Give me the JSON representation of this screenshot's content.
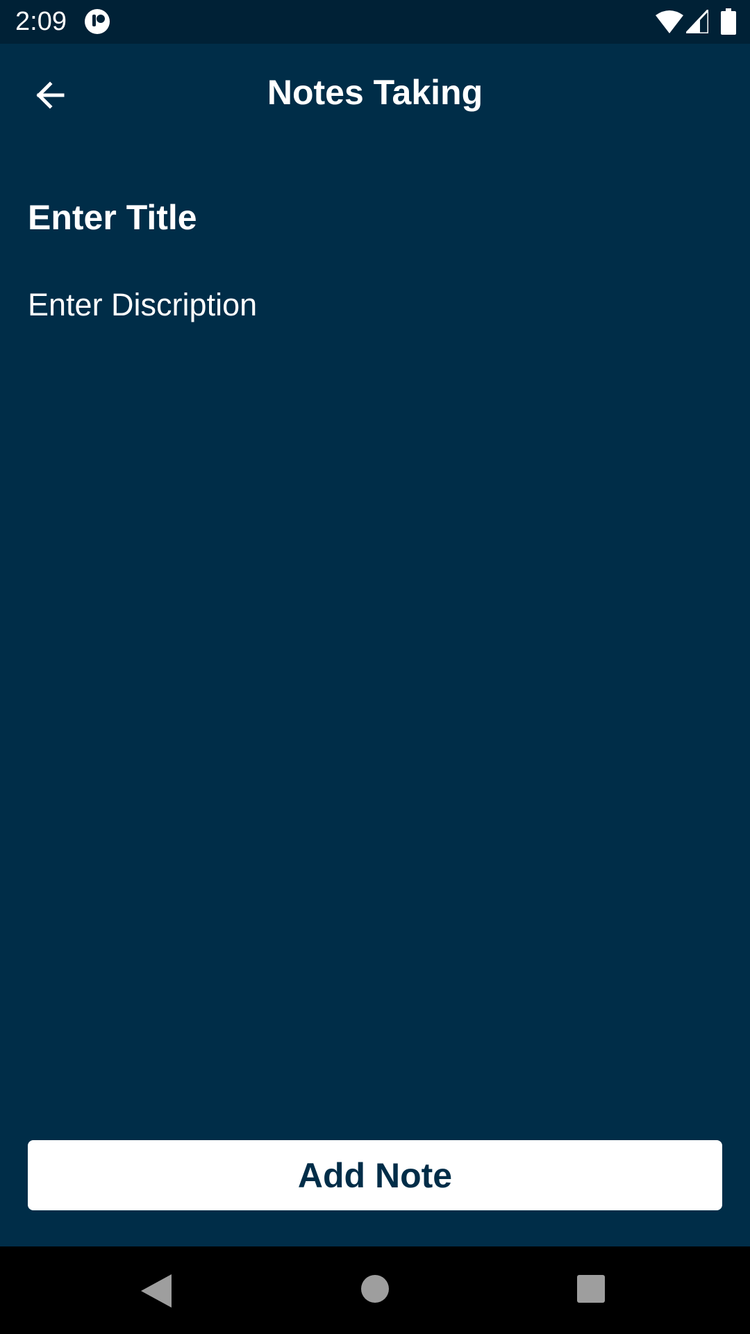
{
  "status_bar": {
    "time": "2:09",
    "icons": [
      "app-notification-icon",
      "wifi-icon",
      "cell-signal-icon",
      "battery-icon"
    ]
  },
  "app_bar": {
    "title": "Notes Taking",
    "back_icon": "arrow-back-icon"
  },
  "form": {
    "title_placeholder": "Enter Title",
    "title_value": "",
    "description_placeholder": "Enter Discription",
    "description_value": ""
  },
  "actions": {
    "add_note_label": "Add Note"
  },
  "nav_bar": {
    "icons": [
      "nav-back-icon",
      "nav-home-icon",
      "nav-recents-icon"
    ]
  },
  "colors": {
    "background": "#002d48",
    "status_bar": "#002136",
    "button_background": "#ffffff",
    "button_text": "#002d48",
    "nav_bar": "#000000"
  }
}
